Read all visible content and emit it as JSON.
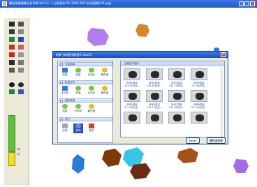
{
  "window": {
    "title": "颗粒形貌图像分析系统  Ver1.0  -  [ 分析图片:01-1000  200 (分析图像) 01.jpg]",
    "colors": {
      "titlebar": "#2558c8",
      "min": "#3a78e0",
      "max": "#3a78e0",
      "close": "#d84a2a"
    }
  },
  "toolbar": {
    "icons": [
      "open-icon",
      "save-icon",
      "zoom-icon",
      "select-icon",
      "cut-icon",
      "pen-icon",
      "line-icon",
      "eraser-icon",
      "measure-icon",
      "grid-icon",
      "text-icon",
      "layer-icon"
    ],
    "bottom_labels": [
      "颗",
      "粒"
    ]
  },
  "dialog": {
    "title": "结果   当前使用数据为:4ba03",
    "close": "✕",
    "sections": [
      {
        "label": "当前结果",
        "items": [
          "结果",
          "粒度",
          "长径比",
          "圆形度"
        ]
      },
      {
        "label": "粒度分布",
        "items": [
          "显分布",
          "粒度",
          "长径比",
          "圆形度"
        ]
      },
      {
        "label": "图形参数",
        "items": [
          "粒度",
          "长径比",
          "圆形度"
        ]
      },
      {
        "label": "其它",
        "items": [
          "比较",
          "查询",
          "保存"
        ]
      }
    ],
    "gallery": {
      "header": "当前显示图片",
      "thumbs": [
        {
          "name": "序号1直径",
          "size": "243.61长径..."
        },
        {
          "name": "序号2直径",
          "size": "243.43长径..."
        },
        {
          "name": "序号3直径",
          "size": "240.75长径..."
        },
        {
          "name": "序号4直径",
          "size": "229.66长径..."
        },
        {
          "name": "序号5直径",
          "size": "227.06长径..."
        },
        {
          "name": "序号6直径",
          "size": "224.17长径..."
        },
        {
          "name": "序号7直径",
          "size": "222.36长径..."
        },
        {
          "name": "序号8直径",
          "size": "221.40长径..."
        },
        {
          "name": "",
          "size": ""
        },
        {
          "name": "",
          "size": ""
        },
        {
          "name": "",
          "size": ""
        },
        {
          "name": "",
          "size": ""
        }
      ]
    },
    "buttons": {
      "excel": "Excel",
      "delete": "删除该结果"
    }
  },
  "blobs": [
    {
      "name": "purple-particle",
      "color": "#b17ef0"
    },
    {
      "name": "orange-particle",
      "color": "#d8862a"
    },
    {
      "name": "yellow-particle",
      "color": "#d6c830"
    },
    {
      "name": "blue-particle-small",
      "color": "#2a7ad8"
    },
    {
      "name": "cyan-particle",
      "color": "#37c6e8"
    },
    {
      "name": "blue-particle",
      "color": "#2a7ad8"
    },
    {
      "name": "brown-particle",
      "color": "#7a3a0a"
    },
    {
      "name": "rust-particle",
      "color": "#a8501a"
    },
    {
      "name": "maroon-particle",
      "color": "#6a2a14"
    },
    {
      "name": "purple-particle-right",
      "color": "#a06ae8"
    }
  ]
}
